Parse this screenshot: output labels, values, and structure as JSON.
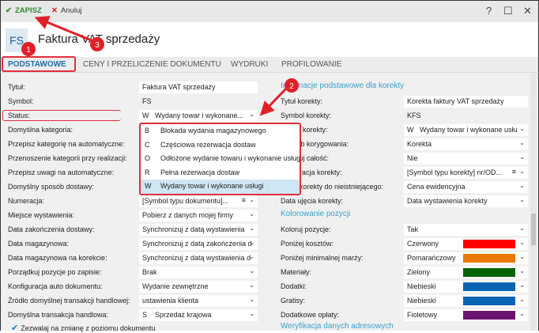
{
  "toolbar": {
    "save": "ZAPISZ",
    "cancel": "Anuluj",
    "help": "?",
    "maximize": "☐",
    "close": "✕"
  },
  "header": {
    "badge": "FS",
    "title": "Faktura VAT sprzedaży"
  },
  "tabs": [
    "PODSTAWOWE",
    "CENY I PRZELICZENIE DOKUMENTU",
    "WYDRUKI",
    "PROFILOWANIE"
  ],
  "left": [
    {
      "label": "Tytuł:",
      "value": "Faktura VAT sprzedaży",
      "type": "text"
    },
    {
      "label": "Symbol:",
      "value": "FS",
      "type": "readonly"
    },
    {
      "label": "Status:",
      "code": "W",
      "value": "Wydany towar i wykonane...",
      "type": "select"
    },
    {
      "label": "Domyślna kategoria:",
      "value": "",
      "type": "select"
    },
    {
      "label": "Przepisz kategorię na automatyczne:",
      "value": "",
      "type": "select"
    },
    {
      "label": "Przenoszenie kategorii przy realizacji:",
      "value": "",
      "type": "select"
    },
    {
      "label": "Przepisz uwagi na automatyczne:",
      "value": "",
      "type": "select"
    },
    {
      "label": "Domyślny sposób dostawy:",
      "value": "",
      "type": "select"
    },
    {
      "label": "Numeracja:",
      "value": "[Symbol typu dokumentu]...",
      "type": "select-menu"
    },
    {
      "label": "Miejsce wystawienia:",
      "value": "Pobierz z danych mojej firmy",
      "type": "select"
    },
    {
      "label": "Data zakończenia dostawy:",
      "value": "Synchronizuj z datą wystawienia",
      "type": "select"
    },
    {
      "label": "Data magazynowa:",
      "value": "Synchronizuj z datą zakończenia d",
      "type": "select"
    },
    {
      "label": "Data magazynowa na korekcie:",
      "value": "Synchronizuj z datą wystawienia d",
      "type": "select"
    },
    {
      "label": "Porządkuj pozycje po zapisie:",
      "value": "Brak",
      "type": "select"
    },
    {
      "label": "Konfiguracja auto dokumentu:",
      "value": "Wydanie zewnętrzne",
      "type": "select"
    },
    {
      "label": "Źródło domyślnej transakcji handlowej:",
      "value": "ustawienia klienta",
      "type": "select"
    },
    {
      "label": "Domyślna transakcja handlowa:",
      "code": "S",
      "value": "Sprzedaż krajowa",
      "type": "select"
    }
  ],
  "checkbox": {
    "label": "Zezwalaj na zmianę z poziomu dokumentu",
    "checked": true
  },
  "status_dropdown": [
    {
      "code": "B",
      "label": "Blokada wydania magazynowego"
    },
    {
      "code": "C",
      "label": "Częściowa rezerwacja dostaw"
    },
    {
      "code": "O",
      "label": "Odłożone wydanie towaru i wykonanie usług"
    },
    {
      "code": "R",
      "label": "Pełna rezerwacja dostaw"
    },
    {
      "code": "W",
      "label": "Wydany towar i wykonane usługi",
      "selected": true
    }
  ],
  "right": {
    "section1": "Informacje podstawowe dla korekty",
    "rows1": [
      {
        "label": "Tytuł korekty:",
        "value": "Korekta faktury VAT sprzedaży",
        "type": "text"
      },
      {
        "label": "Symbol korekty:",
        "value": "KFS",
        "type": "readonly"
      },
      {
        "label": "Status korekty:",
        "code": "W",
        "value": "Wydany towar i wykonane usłu",
        "type": "select"
      },
      {
        "label": "Sposób korygowania:",
        "value": "Korekta",
        "type": "select"
      },
      {
        "label": "Koryguj całość:",
        "value": "Nie",
        "type": "select"
      },
      {
        "label": "Numeracja korekty:",
        "value": "[Symbol typu korekty] nr/OD...",
        "type": "select-menu"
      },
      {
        "label": "Cena korekty do nieistniejącego:",
        "value": "Cena ewidencyjna",
        "type": "select"
      },
      {
        "label": "Data ujęcia korekty:",
        "value": "Data wystawienia korekty",
        "type": "select"
      }
    ],
    "section2": "Kolorowanie pozycji",
    "rows2": [
      {
        "label": "Koloruj pozycje:",
        "value": "Tak"
      },
      {
        "label": "Poniżej kosztów:",
        "value": "Czerwony",
        "color": "#ff0000"
      },
      {
        "label": "Poniżej minimalnej marży:",
        "value": "Pomarańczowy",
        "color": "#e87800"
      },
      {
        "label": "Materiały:",
        "value": "Zielony",
        "color": "#006400"
      },
      {
        "label": "Dodatki:",
        "value": "Niebieski",
        "color": "#0a64b4"
      },
      {
        "label": "Gratisy:",
        "value": "Niebieski",
        "color": "#0a64b4"
      },
      {
        "label": "Dodatkowe opłaty:",
        "value": "Fioletowy",
        "color": "#6a1470"
      }
    ],
    "section3": "Weryfikacja danych adresowych"
  },
  "annotations": [
    "1",
    "2",
    "3"
  ]
}
